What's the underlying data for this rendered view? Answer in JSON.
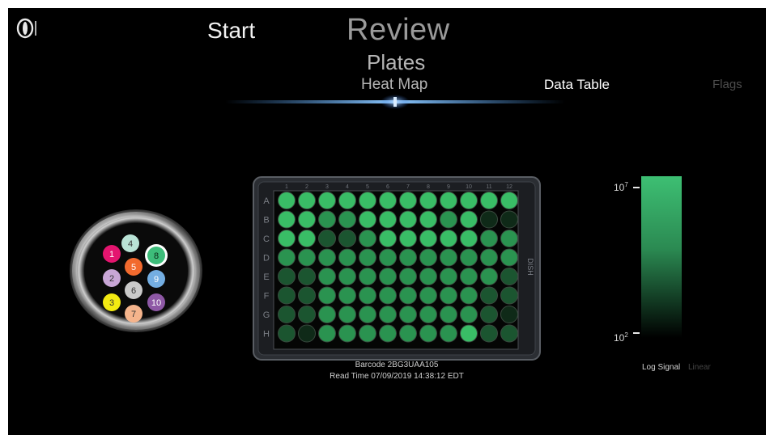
{
  "header": {
    "start_label": "Start",
    "review_label": "Review",
    "plates_label": "Plates"
  },
  "tabs": [
    {
      "label": "Heat Map",
      "active": true
    },
    {
      "label": "Data Table",
      "active": false
    },
    {
      "label": "Flags",
      "active": false
    }
  ],
  "plate": {
    "columns": [
      "1",
      "2",
      "3",
      "4",
      "5",
      "6",
      "7",
      "8",
      "9",
      "10",
      "11",
      "12"
    ],
    "rows": [
      "A",
      "B",
      "C",
      "D",
      "E",
      "F",
      "G",
      "H"
    ],
    "side_label": "DISH",
    "barcode": "Barcode 2BG3UAA105",
    "read_time": "Read Time 07/09/2019 14:38:12 EDT",
    "well_levels": [
      [
        3,
        3,
        3,
        3,
        3,
        3,
        3,
        3,
        3,
        3,
        3,
        3
      ],
      [
        3,
        3,
        2,
        2,
        3,
        3,
        3,
        3,
        2,
        3,
        0,
        0
      ],
      [
        3,
        3,
        1,
        1,
        2,
        3,
        3,
        3,
        3,
        3,
        2,
        2
      ],
      [
        2,
        2,
        2,
        2,
        2,
        2,
        2,
        2,
        2,
        2,
        2,
        2
      ],
      [
        1,
        1,
        2,
        2,
        2,
        2,
        2,
        2,
        2,
        2,
        2,
        1
      ],
      [
        1,
        1,
        2,
        2,
        2,
        2,
        2,
        2,
        2,
        2,
        1,
        1
      ],
      [
        1,
        1,
        2,
        2,
        2,
        2,
        2,
        2,
        2,
        2,
        1,
        0
      ],
      [
        1,
        0,
        2,
        2,
        2,
        2,
        2,
        2,
        2,
        3,
        1,
        1
      ]
    ],
    "level_colors": [
      "#0f2a18",
      "#1b5530",
      "#2a9350",
      "#39bd66"
    ]
  },
  "legend": {
    "top_label": "10",
    "top_exp": "7",
    "bottom_label": "10",
    "bottom_exp": "2",
    "log_label": "Log Signal",
    "linear_label": "Linear"
  },
  "wheel": {
    "selected": "8",
    "chips": [
      {
        "n": "1",
        "color": "#e4156f",
        "text": "#ffffff"
      },
      {
        "n": "4",
        "color": "#b9e3d6",
        "text": "#333333"
      },
      {
        "n": "8",
        "color": "#3dbd7a",
        "text": "#0a2a18"
      },
      {
        "n": "2",
        "color": "#c8a6d6",
        "text": "#333333"
      },
      {
        "n": "5",
        "color": "#f26a2e",
        "text": "#ffffff"
      },
      {
        "n": "9",
        "color": "#74aee2",
        "text": "#ffffff"
      },
      {
        "n": "3",
        "color": "#f3ea12",
        "text": "#333333"
      },
      {
        "n": "6",
        "color": "#c9c9c9",
        "text": "#333333"
      },
      {
        "n": "10",
        "color": "#8e58a5",
        "text": "#ffffff"
      },
      {
        "n": "7",
        "color": "#f5b48c",
        "text": "#333333"
      }
    ]
  },
  "colors": {
    "accent_blue": "#4da3ff",
    "legend_green": "#3dbf73"
  }
}
